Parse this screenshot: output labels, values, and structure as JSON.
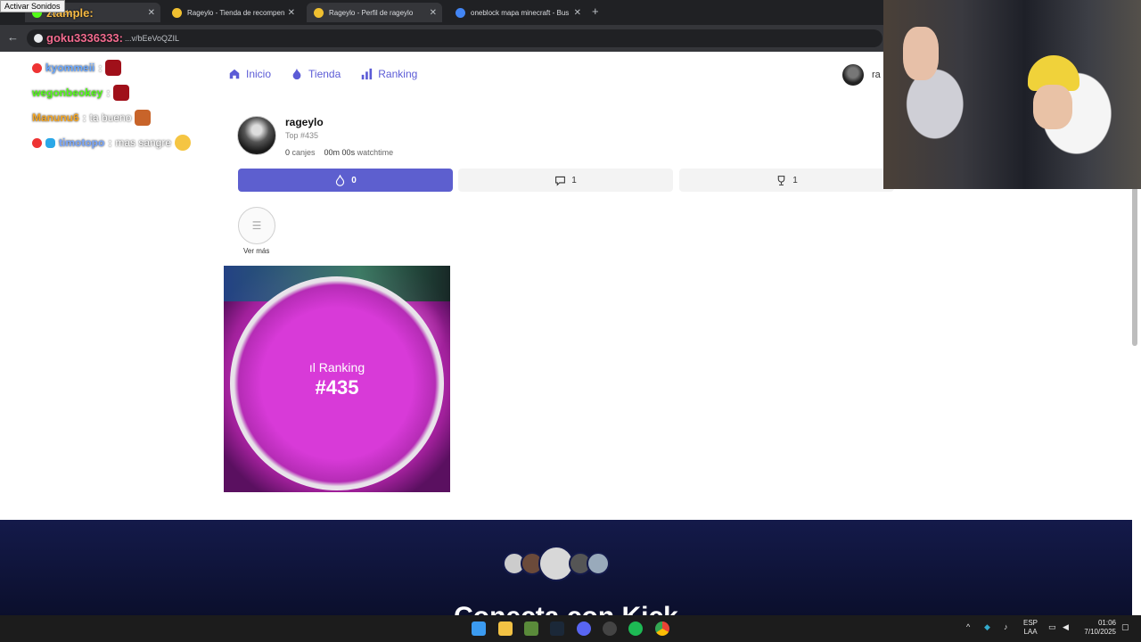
{
  "browser": {
    "tabs": [
      {
        "label": "ztample: ...",
        "fav_color": "#53fc18"
      },
      {
        "label": "Rageylo - Tienda de recompen",
        "fav_color": "#f0c030"
      },
      {
        "label": "Rageylo - Perfil de rageylo",
        "fav_color": "#f0c030"
      },
      {
        "label": "oneblock mapa minecraft - Bus",
        "fav_color": "#4285f4"
      }
    ],
    "sound_tip": "Activar Sonidos",
    "url_suffix": "...v/bEeVoQZIL"
  },
  "nav": {
    "items": [
      {
        "label": "Inicio",
        "icon": "home-icon"
      },
      {
        "label": "Tienda",
        "icon": "flame-icon"
      },
      {
        "label": "Ranking",
        "icon": "bar-chart-icon"
      }
    ],
    "user_short": "ra"
  },
  "profile": {
    "name": "rageylo",
    "top": "Top #435",
    "canjes_value": "0",
    "canjes_label": "canjes",
    "watch_value": "00m 00s",
    "watch_label": "watchtime"
  },
  "stat_tabs": [
    {
      "icon": "flame-icon",
      "value": "0"
    },
    {
      "icon": "message-icon",
      "value": "1"
    },
    {
      "icon": "trophy-icon",
      "value": "1"
    }
  ],
  "ver_mas": "Ver más",
  "card": {
    "rank_label": "ıl Ranking",
    "rank_value": "#435"
  },
  "footer": {
    "title": "Conecta con Kick"
  },
  "chat": [
    {
      "user": "kyommeii",
      "color": "#6aa8ff",
      "msg": ""
    },
    {
      "user": "wegonbeokey",
      "color": "#53fc18",
      "msg": ""
    },
    {
      "user": "Manunu6",
      "color": "#f5a623",
      "msg": "ta bueno"
    },
    {
      "user": "timotopo",
      "color": "#7aa9ff",
      "msg": "mas sangre"
    }
  ],
  "chat_overlay_top": "goku3336333:",
  "chat_overlay_tab": "ztample:",
  "taskbar": {
    "lang": [
      "ESP",
      "LAA"
    ],
    "time": "01:06",
    "date": "7/10/2025"
  }
}
